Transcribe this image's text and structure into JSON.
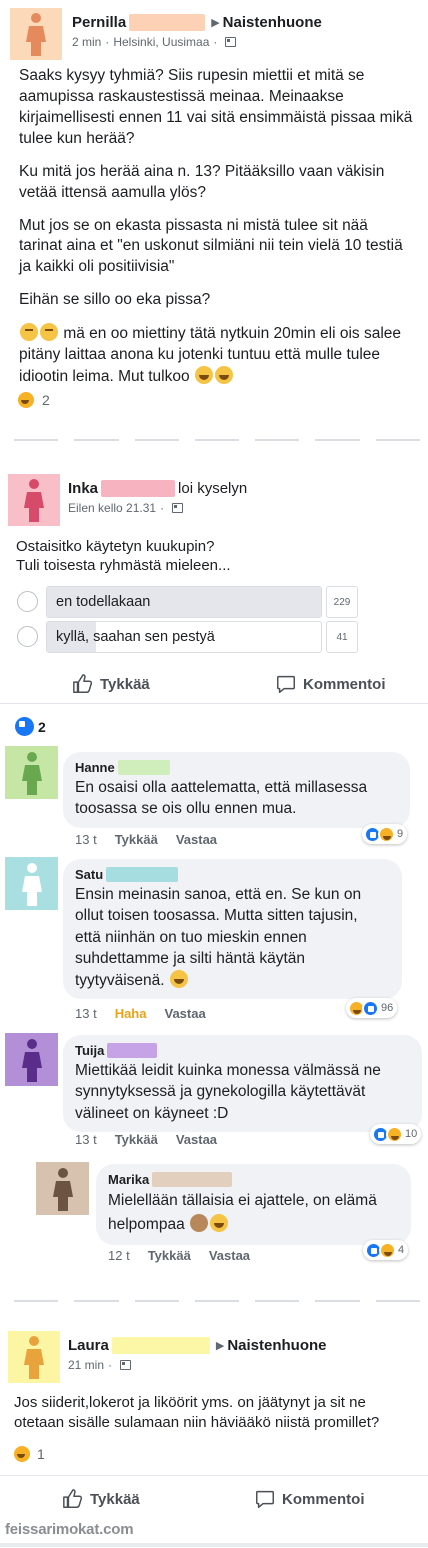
{
  "post1": {
    "author": "Pernilla",
    "group": "Naistenhuone",
    "time": "2 min",
    "location": "Helsinki, Uusimaa",
    "paragraphs": [
      "Saaks kysyy tyhmiä? Siis rupesin miettii et mitä se aamupissa raskaustestissä meinaa. Meinaakse kirjaimellisesti ennen 11 vai sitä ensimmäistä pissaa mikä tulee kun herää?",
      "Ku mitä jos herää aina n. 13? Pitääksillo vaan väkisin vetää ittensä aamulla ylös?",
      "Mut jos se on ekasta pissasta ni mistä tulee sit nää tarinat aina et \"en uskonut silmiäni nii tein vielä 10 testiä ja kaikki oli positiivisia\"",
      "Eihän se sillo oo eka pissa?"
    ],
    "last_paragraph": "mä en oo miettiny tätä nytkuin 20min eli ois salee pitäny laittaa anona ku jotenki tuntuu että mulle tulee idiootin leima. Mut tulkoo",
    "reaction_count": "2",
    "colors": {
      "avatar_bg": "#fbd9b9",
      "avatar_figure": "#e58a5d",
      "redact": "#fcd1b5"
    }
  },
  "post2": {
    "author": "Inka",
    "action": "loi kyselyn",
    "time": "Eilen kello 21.31",
    "question_line1": "Ostaisitko käytetyn kuukupin?",
    "question_line2": "Tuli toisesta ryhmästä mieleen...",
    "poll": [
      {
        "label": "en todellakaan",
        "count": "229",
        "fraction": 1.0
      },
      {
        "label": "kyllä, saahan sen pestyä",
        "count": "41",
        "fraction": 0.18
      }
    ],
    "like_label": "Tykkää",
    "comment_label": "Kommentoi",
    "like_count": "2",
    "colors": {
      "avatar_bg": "#f9bfc8",
      "avatar_figure": "#d64a6a",
      "redact": "#f7b4c0"
    }
  },
  "comments": [
    {
      "name": "Hanne",
      "text_lines": [
        "En osaisi olla aattelematta, että millasessa",
        "toosassa se ois ollu ennen mua."
      ],
      "time": "13 t",
      "like": "Tykkää",
      "reply": "Vastaa",
      "reactions": "9",
      "colors": {
        "avatar_bg": "#c6e6a6",
        "avatar_figure": "#6aa84f",
        "redact": "#cfeebb"
      }
    },
    {
      "name": "Satu",
      "text_lines": [
        "Ensin meinasin sanoa, että en. Se kun on",
        "ollut toisen toosassa. Mutta sitten tajusin,",
        "että niinhän on tuo mieskin ennen",
        "suhdettamme ja silti häntä käytän",
        "tyytyväisenä."
      ],
      "time": "13 t",
      "like": "Haha",
      "reply": "Vastaa",
      "reactions": "96",
      "colors": {
        "avatar_bg": "#a9dfe0",
        "avatar_figure": "#ffffff",
        "redact": "#a6dde0"
      }
    },
    {
      "name": "Tuija",
      "text_lines": [
        "Miettikää leidit kuinka monessa välmässä ne",
        "synnytyksessä ja gynekologilla käytettävät",
        "välineet on käyneet :D"
      ],
      "time": "13 t",
      "like": "Tykkää",
      "reply": "Vastaa",
      "reactions": "10",
      "colors": {
        "avatar_bg": "#b38fd8",
        "avatar_figure": "#5b2d8a",
        "redact": "#c5a3e6"
      }
    },
    {
      "name": "Marika",
      "text_lines": [
        "Mielellään tällaisia ei ajattele, on elämä",
        "helpompaa"
      ],
      "time": "12 t",
      "like": "Tykkää",
      "reply": "Vastaa",
      "reactions": "4",
      "colors": {
        "avatar_bg": "#d6c2ae",
        "avatar_figure": "#6b5442",
        "redact": "#e3cfbe"
      }
    }
  ],
  "post3": {
    "author": "Laura",
    "group": "Naistenhuone",
    "time": "21 min",
    "text": "Jos siiderit,lokerot ja liköörit yms. on jäätynyt ja sit ne otetaan sisälle sulamaan niin häviääkö niistä promillet?",
    "reaction_count": "1",
    "like_label": "Tykkää",
    "comment_label": "Kommentoi",
    "colors": {
      "avatar_bg": "#fbf5a4",
      "avatar_figure": "#e8a33c",
      "redact": "#fbf7a6"
    }
  },
  "watermark": "feissarimokat.com"
}
